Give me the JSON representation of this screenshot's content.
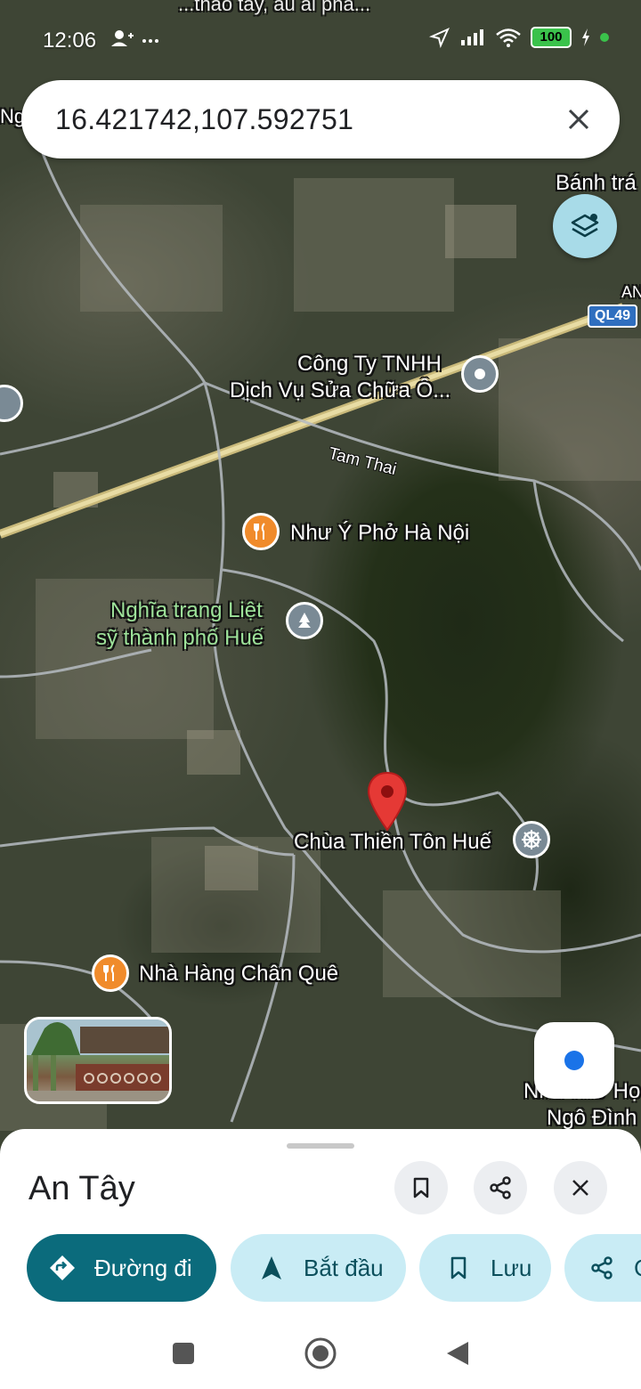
{
  "status_bar": {
    "time": "12:06",
    "left_icons": [
      "person-add-icon",
      "more-icon"
    ],
    "right_icons": [
      "location-arrow-icon",
      "signal-icon",
      "wifi-icon",
      "battery-icon",
      "charging-icon"
    ],
    "battery": "100"
  },
  "search": {
    "query": "16.421742,107.592751"
  },
  "map": {
    "labels": {
      "poi_company_line1": "Công Ty TNHH",
      "poi_company_line2": "Dịch Vụ Sửa Chữa Ô...",
      "road_tam_thai": "Tam Thai",
      "poi_pho": "Như Ý Phở Hà Nội",
      "cemetery_line1": "Nghĩa trang Liệt",
      "cemetery_line2": "sỹ thành phố Huế",
      "pagoda": "Chùa Thiền Tôn Huế",
      "restaurant": "Nhà Hàng Chân Quê",
      "top_right": "Bánh trá",
      "bottom_right_line1": "Nhà Thờ Họ",
      "bottom_right_line2": "Ngô Đình",
      "top_left": "Ng",
      "right_edge": "AN",
      "highway_shield": "QL49",
      "cut_top": "...thao tây, ấu ai phả..."
    }
  },
  "sheet": {
    "title": "An Tây",
    "actions": {
      "directions": "Đường đi",
      "start": "Bắt đầu",
      "save": "Lưu",
      "share": "C"
    }
  },
  "colors": {
    "primary_chip": "#0b6b7c",
    "secondary_chip": "#c9ecf5",
    "pin": "#e53935",
    "food_poi": "#f08b2b",
    "my_location": "#1a73e8"
  }
}
